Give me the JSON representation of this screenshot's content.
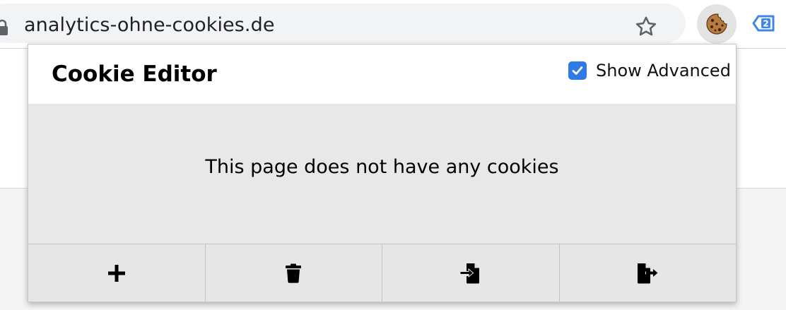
{
  "browser": {
    "url": "analytics-ohne-cookies.de",
    "icons": {
      "lock": "lock-icon",
      "bookmark": "star-icon",
      "extension_cookie": "cookie-icon",
      "extension_tag": "tag-badge-icon"
    },
    "tag_badge": "2"
  },
  "popup": {
    "title": "Cookie Editor",
    "show_advanced": {
      "label": "Show Advanced",
      "checked": true
    },
    "empty_message": "This page does not have any cookies",
    "footer_buttons": [
      {
        "icon": "plus-icon",
        "action": "add"
      },
      {
        "icon": "trash-icon",
        "action": "delete-all"
      },
      {
        "icon": "import-icon",
        "action": "import"
      },
      {
        "icon": "export-icon",
        "action": "export"
      }
    ]
  },
  "colors": {
    "checkbox_accent": "#2f7ae5",
    "body_bg": "#e8e8e8",
    "footer_bg": "#e6e6e6",
    "omnibox_bg": "#f1f3f4"
  }
}
